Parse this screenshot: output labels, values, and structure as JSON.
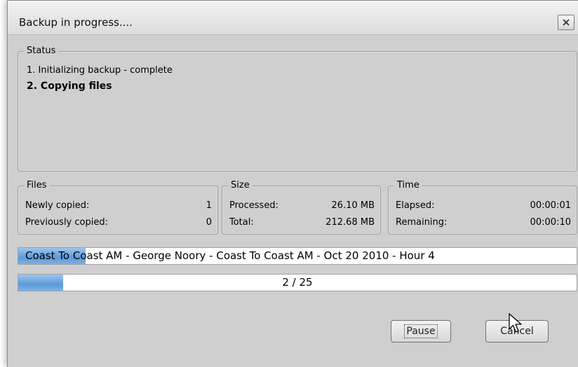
{
  "window": {
    "title": "Backup in progress....",
    "close_label": "X"
  },
  "status": {
    "legend": "Status",
    "lines": [
      "1. Initializing backup - complete",
      "2. Copying files"
    ]
  },
  "files": {
    "legend": "Files",
    "newly_copied_label": "Newly copied:",
    "newly_copied_value": "1",
    "previously_copied_label": "Previously copied:",
    "previously_copied_value": "0"
  },
  "size": {
    "legend": "Size",
    "processed_label": "Processed:",
    "processed_value": "26.10 MB",
    "total_label": "Total:",
    "total_value": "212.68 MB"
  },
  "time": {
    "legend": "Time",
    "elapsed_label": "Elapsed:",
    "elapsed_value": "00:00:01",
    "remaining_label": "Remaining:",
    "remaining_value": "00:00:10"
  },
  "progress": {
    "current_file": "Coast To Coast AM - George Noory - Coast To Coast AM - Oct 20 2010 - Hour 4",
    "file_fraction": 0.12,
    "count_text": "2 / 25",
    "count_fraction": 0.08,
    "fill_color": "#5d9ad8"
  },
  "buttons": {
    "pause": "Pause",
    "cancel": "Cancel"
  },
  "icons": {
    "close": "close-icon",
    "cursor": "mouse-pointer-icon"
  }
}
